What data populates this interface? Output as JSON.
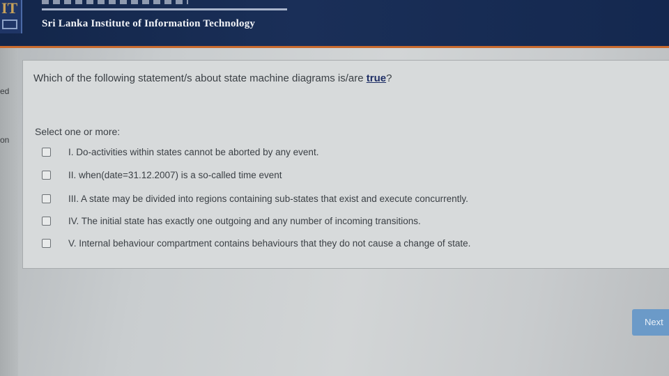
{
  "header": {
    "logo_text": "IT",
    "institute_name": "Sri Lanka Institute of Information Technology"
  },
  "side_nav": {
    "fragment_1": "ed",
    "fragment_2": "on"
  },
  "question": {
    "text_before": "Which of the following statement/s about state machine diagrams is/are ",
    "emphasis": "true",
    "text_after": "?",
    "prompt": "Select one or more:",
    "options": [
      {
        "label": "I. Do-activities within states cannot be aborted by any event.",
        "checked": false
      },
      {
        "label": "II. when(date=31.12.2007) is a so-called time event",
        "checked": false
      },
      {
        "label": "III. A state may be divided into regions containing sub-states that exist and execute concurrently.",
        "checked": false
      },
      {
        "label": "IV. The initial state has exactly one outgoing and any number of incoming transitions.",
        "checked": false
      },
      {
        "label": "V. Internal behaviour compartment contains behaviours that they do not cause a change of state.",
        "checked": false
      }
    ]
  },
  "navigation": {
    "next_label": "Next"
  },
  "colors": {
    "header_bg": "#13264a",
    "header_accent": "#c96a2e",
    "next_button": "#6b9ac8",
    "emphasis": "#1f2f66"
  }
}
